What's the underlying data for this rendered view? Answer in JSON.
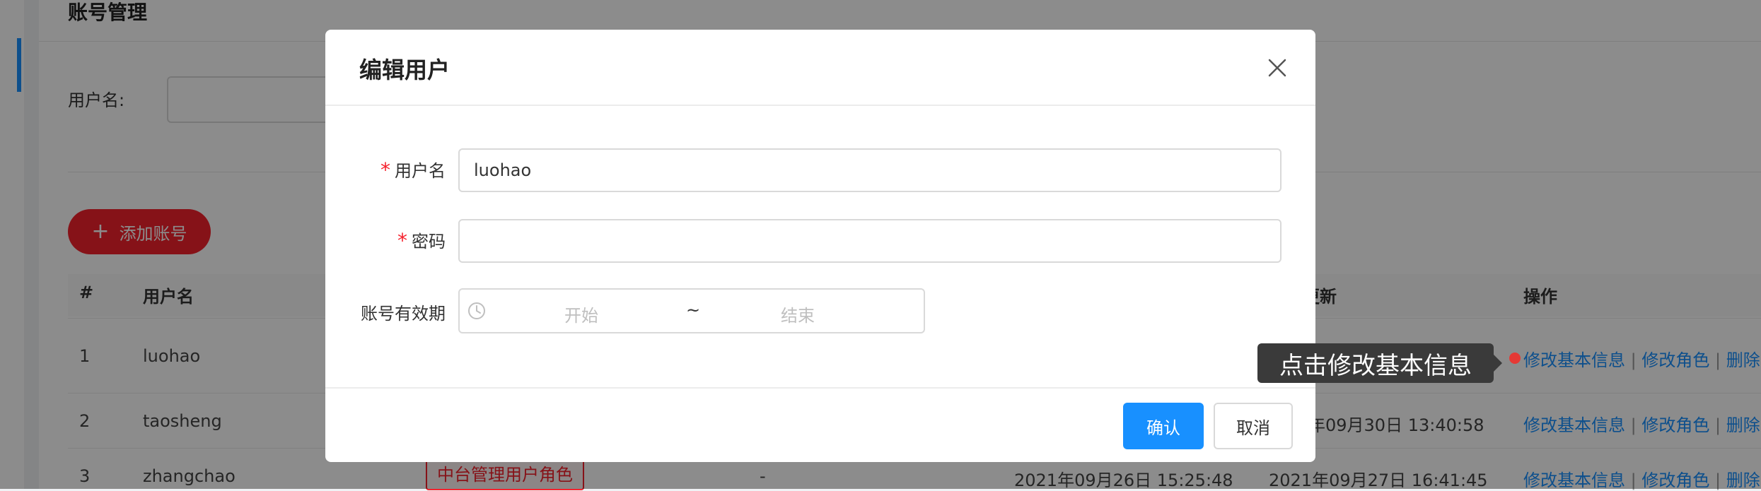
{
  "page": {
    "title": "账号管理",
    "filter_label": "用户名:",
    "add_button": "添加账号",
    "add_icon": "plus-icon"
  },
  "table": {
    "headers": [
      "#",
      "用户名",
      "更新",
      "操作"
    ],
    "rows": [
      {
        "index": "1",
        "username": "luohao",
        "role": "",
        "dash": "",
        "created": "",
        "updated": ""
      },
      {
        "index": "2",
        "username": "taosheng",
        "role": "",
        "dash": "",
        "created": "",
        "updated": "年09月30日 13:40:58"
      },
      {
        "index": "3",
        "username": "zhangchao",
        "role": "中台管理用户角色",
        "dash": "-",
        "created": "2021年09月26日 15:25:48",
        "updated": "2021年09月27日 16:41:45"
      }
    ],
    "ops": {
      "edit_info": "修改基本信息",
      "sep": "|",
      "edit_role": "修改角色",
      "delete": "删除"
    }
  },
  "modal": {
    "title": "编辑用户",
    "close_icon": "close-icon",
    "username_label": "用户名",
    "username_value": "luohao",
    "password_label": "密码",
    "password_value": "",
    "required_mark": "*",
    "validity_label": "账号有效期",
    "start_placeholder": "开始",
    "range_sep": "~",
    "end_placeholder": "结束",
    "ok_label": "确认",
    "cancel_label": "取消"
  },
  "tooltip": {
    "text": "点击修改基本信息"
  },
  "colors": {
    "primary": "#1890ff",
    "danger": "#f5222d",
    "tooltip_bg": "#3a3a3a"
  }
}
